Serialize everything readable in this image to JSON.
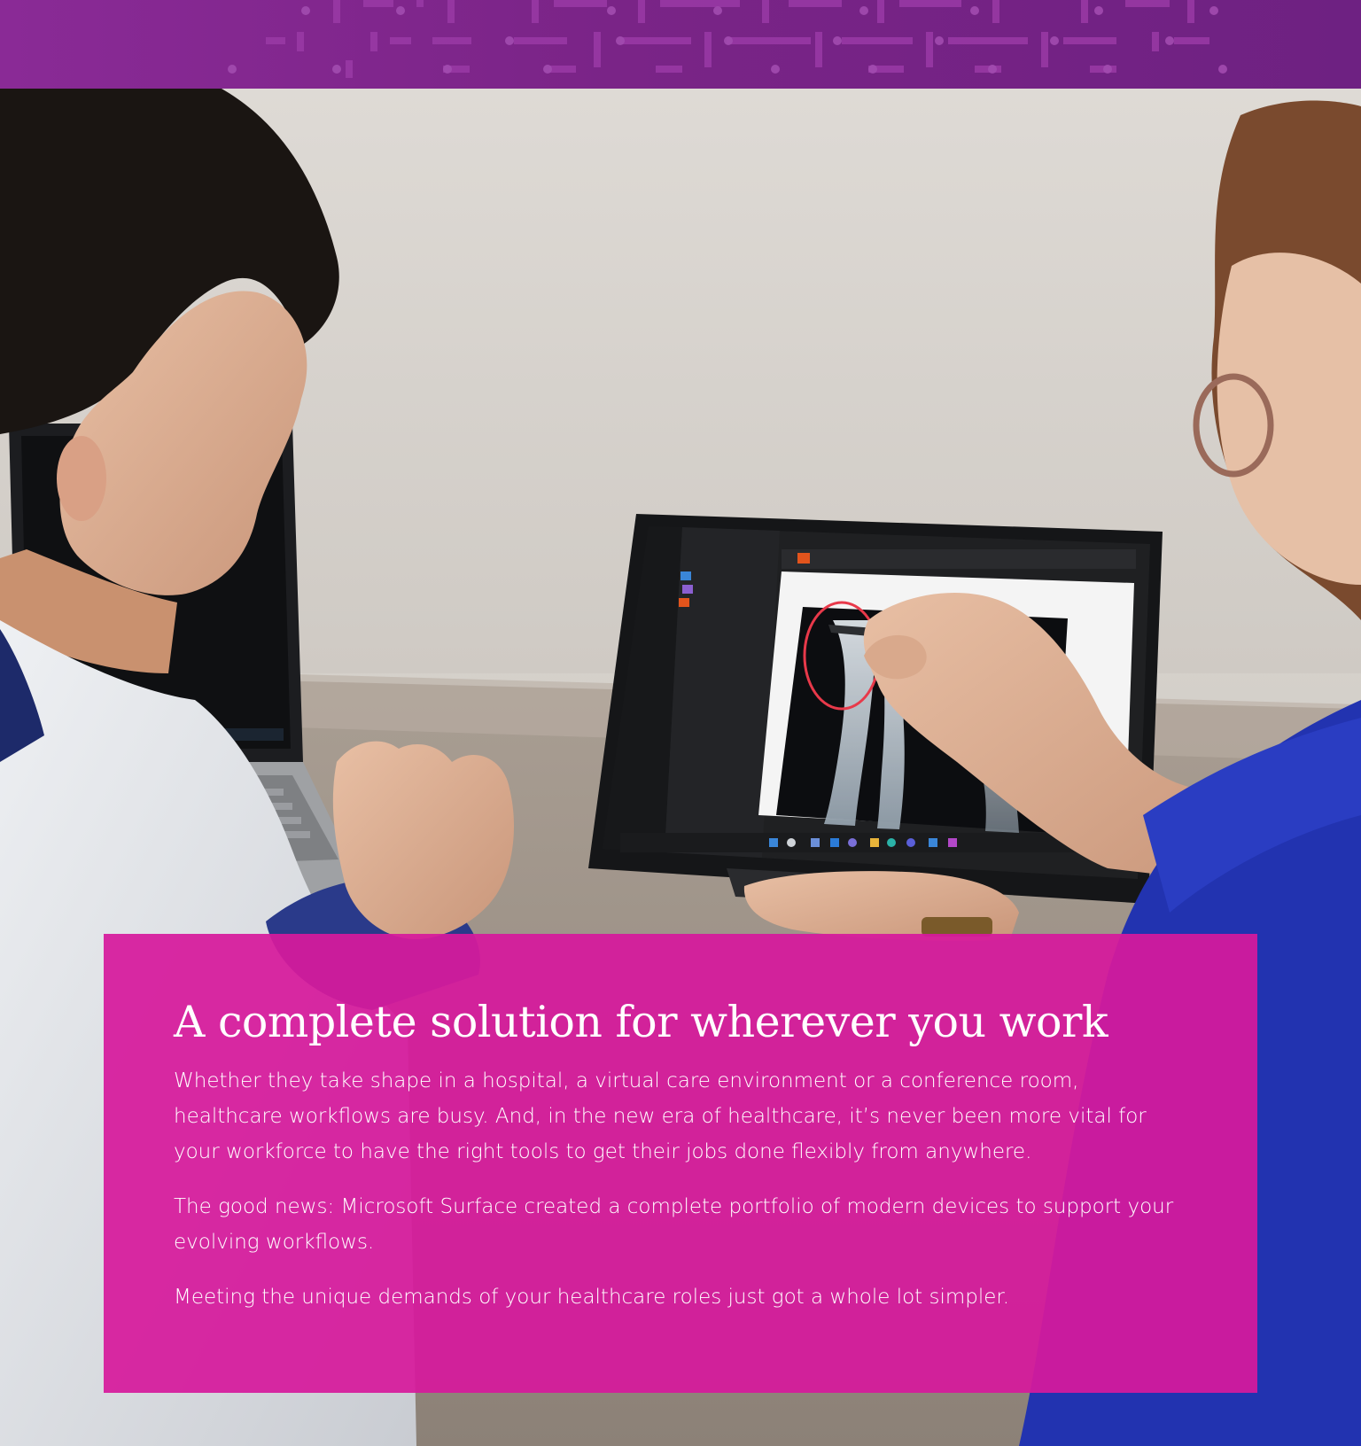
{
  "brand": {
    "header_color_start": "#8a2a96",
    "header_color_end": "#6e2182",
    "panel_color": "#d61a9c"
  },
  "hero_image": {
    "icon": "photo-doctors-with-surface-tablet"
  },
  "content": {
    "headline": "A complete solution for wherever you work",
    "paragraphs": [
      "Whether they take shape in a hospital, a virtual care environment or a conference room, healthcare workflows are busy. And, in the new era of healthcare, it’s never been more vital for your workforce to have the right tools to get their jobs done flexibly from anywhere.",
      "The good news: Microsoft Surface created a complete portfolio of modern devices to support your evolving workflows.",
      "Meeting the unique demands of your healthcare roles just got a whole lot simpler."
    ]
  }
}
